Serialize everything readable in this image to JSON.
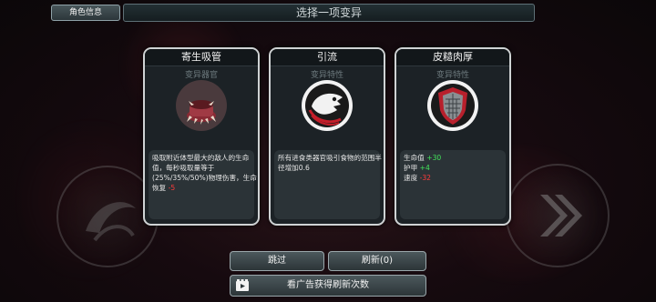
{
  "header": {
    "character_button": "角色信息",
    "title": "选择一项变异"
  },
  "cards": [
    {
      "title": "寄生吸管",
      "subtitle": "变异器官",
      "icon": "parasite-mouth-icon",
      "desc_lines": [
        "吸取附近体型最大的敌人的生命",
        "值，每秒吸取量等于",
        "(25%/35%/50%)物理伤害，生命",
        "恢复 "
      ],
      "desc_value": "-5"
    },
    {
      "title": "引流",
      "subtitle": "变异特性",
      "icon": "fish-skull-icon",
      "desc_lines": [
        "所有进食类器官吸引食物的范围半",
        "径增加0.6"
      ]
    },
    {
      "title": "皮糙肉厚",
      "subtitle": "变异特性",
      "icon": "shield-icon",
      "stats": [
        {
          "label": "生命值 ",
          "value": "+30",
          "color": "green"
        },
        {
          "label": "护甲 ",
          "value": "+4",
          "color": "green"
        },
        {
          "label": "速度 ",
          "value": "-32",
          "color": "red"
        }
      ]
    }
  ],
  "buttons": {
    "skip": "跳过",
    "refresh": "刷新(0)",
    "watch_ad": "看广告获得刷新次数"
  },
  "colors": {
    "accent_red": "#ff3b3b",
    "accent_green": "#42e35a",
    "card_border": "#cfd3d4"
  }
}
